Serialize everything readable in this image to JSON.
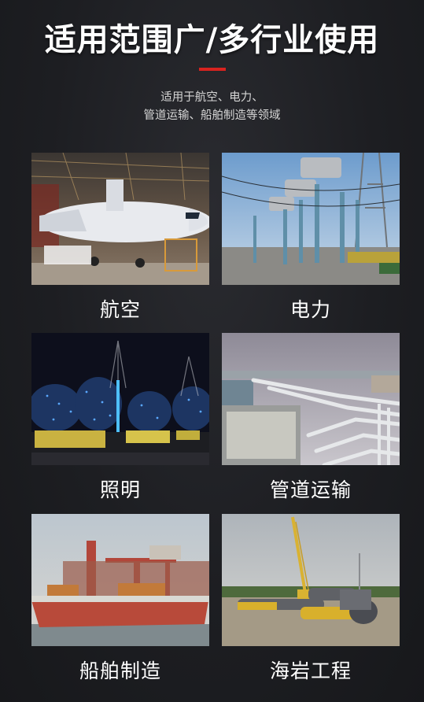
{
  "header": {
    "title": "适用范围广/多行业使用",
    "subtitle_line1": "适用于航空、电力、",
    "subtitle_line2": "管道运输、船舶制造等领域",
    "accent_color": "#d8231f"
  },
  "industries": [
    {
      "label": "航空",
      "image": "aircraft-hangar-photo"
    },
    {
      "label": "电力",
      "image": "power-substation-photo"
    },
    {
      "label": "照明",
      "image": "night-lighting-photo"
    },
    {
      "label": "管道运输",
      "image": "pipeline-plant-photo"
    },
    {
      "label": "船舶制造",
      "image": "shipyard-photo"
    },
    {
      "label": "海岩工程",
      "image": "pipe-construction-site-photo"
    }
  ]
}
